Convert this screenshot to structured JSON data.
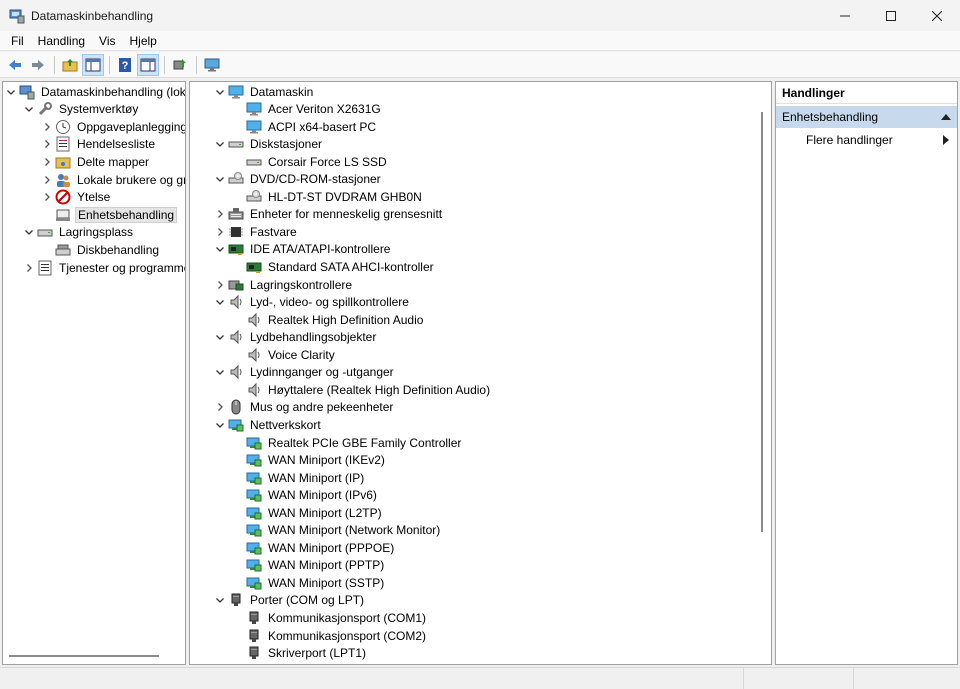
{
  "window": {
    "title": "Datamaskinbehandling"
  },
  "menu": [
    "Fil",
    "Handling",
    "Vis",
    "Hjelp"
  ],
  "left_tree": [
    {
      "label": "Datamaskinbehandling (lokal)",
      "level": 0,
      "expanded": true,
      "icon": "computer-management-icon"
    },
    {
      "label": "Systemverktøy",
      "level": 1,
      "expanded": true,
      "icon": "tools-icon"
    },
    {
      "label": "Oppgaveplanlegging",
      "level": 2,
      "expanded": false,
      "icon": "clock-icon"
    },
    {
      "label": "Hendelsesliste",
      "level": 2,
      "expanded": false,
      "icon": "event-log-icon"
    },
    {
      "label": "Delte mapper",
      "level": 2,
      "expanded": false,
      "icon": "shared-folder-icon"
    },
    {
      "label": "Lokale brukere og grupp",
      "level": 2,
      "expanded": false,
      "icon": "users-icon"
    },
    {
      "label": "Ytelse",
      "level": 2,
      "expanded": false,
      "icon": "performance-icon"
    },
    {
      "label": "Enhetsbehandling",
      "level": 2,
      "leaf": true,
      "selected": true,
      "icon": "device-manager-icon"
    },
    {
      "label": "Lagringsplass",
      "level": 1,
      "expanded": true,
      "icon": "storage-icon"
    },
    {
      "label": "Diskbehandling",
      "level": 2,
      "leaf": true,
      "icon": "disk-management-icon"
    },
    {
      "label": "Tjenester og programmer",
      "level": 1,
      "expanded": false,
      "icon": "services-icon"
    }
  ],
  "device_tree": [
    {
      "label": "Datamaskin",
      "level": 0,
      "expanded": true,
      "icon": "monitor-icon"
    },
    {
      "label": "Acer Veriton X2631G",
      "level": 1,
      "icon": "monitor-icon"
    },
    {
      "label": "ACPI x64-basert PC",
      "level": 1,
      "icon": "monitor-icon"
    },
    {
      "label": "Diskstasjoner",
      "level": 0,
      "expanded": true,
      "icon": "disk-drive-icon"
    },
    {
      "label": "Corsair Force LS SSD",
      "level": 1,
      "icon": "disk-drive-icon"
    },
    {
      "label": "DVD/CD-ROM-stasjoner",
      "level": 0,
      "expanded": true,
      "icon": "dvd-drive-icon"
    },
    {
      "label": "HL-DT-ST DVDRAM GHB0N",
      "level": 1,
      "icon": "dvd-drive-icon"
    },
    {
      "label": "Enheter for menneskelig grensesnitt",
      "level": 0,
      "expanded": false,
      "icon": "hid-icon"
    },
    {
      "label": "Fastvare",
      "level": 0,
      "expanded": false,
      "icon": "firmware-icon"
    },
    {
      "label": "IDE ATA/ATAPI-kontrollere",
      "level": 0,
      "expanded": true,
      "icon": "controller-icon"
    },
    {
      "label": "Standard SATA AHCI-kontroller",
      "level": 1,
      "icon": "controller-icon"
    },
    {
      "label": "Lagringskontrollere",
      "level": 0,
      "expanded": false,
      "icon": "storage-controller-icon"
    },
    {
      "label": "Lyd-, video- og spillkontrollere",
      "level": 0,
      "expanded": true,
      "icon": "speaker-icon"
    },
    {
      "label": "Realtek High Definition Audio",
      "level": 1,
      "icon": "speaker-icon"
    },
    {
      "label": "Lydbehandlingsobjekter",
      "level": 0,
      "expanded": true,
      "icon": "speaker-icon"
    },
    {
      "label": "Voice Clarity",
      "level": 1,
      "icon": "speaker-icon"
    },
    {
      "label": "Lydinnganger og -utganger",
      "level": 0,
      "expanded": true,
      "icon": "speaker-icon"
    },
    {
      "label": "Høyttalere (Realtek High Definition Audio)",
      "level": 1,
      "icon": "speaker-icon"
    },
    {
      "label": "Mus og andre pekeenheter",
      "level": 0,
      "expanded": false,
      "icon": "mouse-icon"
    },
    {
      "label": "Nettverkskort",
      "level": 0,
      "expanded": true,
      "icon": "network-adapter-icon"
    },
    {
      "label": "Realtek PCIe GBE Family Controller",
      "level": 1,
      "icon": "network-adapter-icon"
    },
    {
      "label": "WAN Miniport (IKEv2)",
      "level": 1,
      "icon": "network-adapter-icon"
    },
    {
      "label": "WAN Miniport (IP)",
      "level": 1,
      "icon": "network-adapter-icon"
    },
    {
      "label": "WAN Miniport (IPv6)",
      "level": 1,
      "icon": "network-adapter-icon"
    },
    {
      "label": "WAN Miniport (L2TP)",
      "level": 1,
      "icon": "network-adapter-icon"
    },
    {
      "label": "WAN Miniport (Network Monitor)",
      "level": 1,
      "icon": "network-adapter-icon"
    },
    {
      "label": "WAN Miniport (PPPOE)",
      "level": 1,
      "icon": "network-adapter-icon"
    },
    {
      "label": "WAN Miniport (PPTP)",
      "level": 1,
      "icon": "network-adapter-icon"
    },
    {
      "label": "WAN Miniport (SSTP)",
      "level": 1,
      "icon": "network-adapter-icon"
    },
    {
      "label": "Porter (COM og LPT)",
      "level": 0,
      "expanded": true,
      "icon": "port-icon"
    },
    {
      "label": "Kommunikasjonsport (COM1)",
      "level": 1,
      "icon": "port-icon"
    },
    {
      "label": "Kommunikasjonsport (COM2)",
      "level": 1,
      "icon": "port-icon"
    },
    {
      "label": "Skriverport (LPT1)",
      "level": 1,
      "icon": "port-icon"
    }
  ],
  "actions": {
    "header": "Handlinger",
    "group": "Enhetsbehandling",
    "more": "Flere handlinger"
  },
  "colors": {
    "accent": "#0078d4",
    "selection": "#e5e5e5",
    "action_group_bg": "#c7d9ec"
  }
}
